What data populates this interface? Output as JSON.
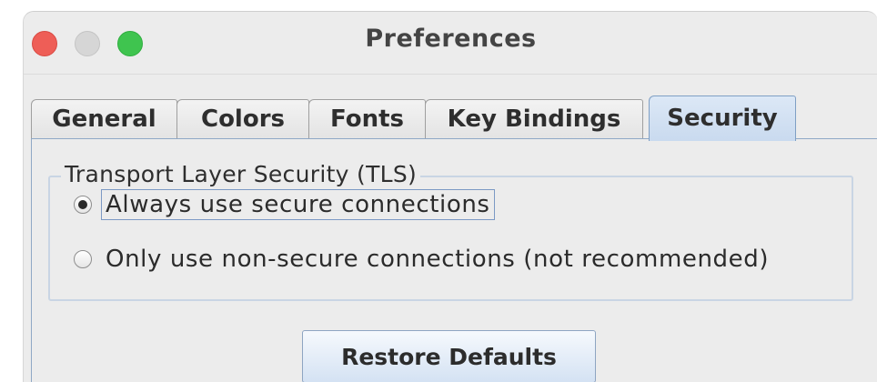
{
  "window": {
    "title": "Preferences"
  },
  "titlebar_buttons": [
    {
      "name": "close",
      "color": "#ee5e57"
    },
    {
      "name": "minimize",
      "color": "#d6d6d6"
    },
    {
      "name": "zoom",
      "color": "#3fc44f"
    }
  ],
  "tabs": [
    {
      "label": "General",
      "selected": false
    },
    {
      "label": "Colors",
      "selected": false
    },
    {
      "label": "Fonts",
      "selected": false
    },
    {
      "label": "Key Bindings",
      "selected": false
    },
    {
      "label": "Security",
      "selected": true
    }
  ],
  "security": {
    "group_title": "Transport Layer Security (TLS)",
    "options": [
      {
        "label": "Always use secure connections",
        "checked": true
      },
      {
        "label": "Only use non-secure connections (not recommended)",
        "checked": false
      }
    ],
    "restore_button": "Restore Defaults"
  },
  "colors": {
    "accent_tab": "#c9daef",
    "panel_border": "#8fa8c6"
  }
}
